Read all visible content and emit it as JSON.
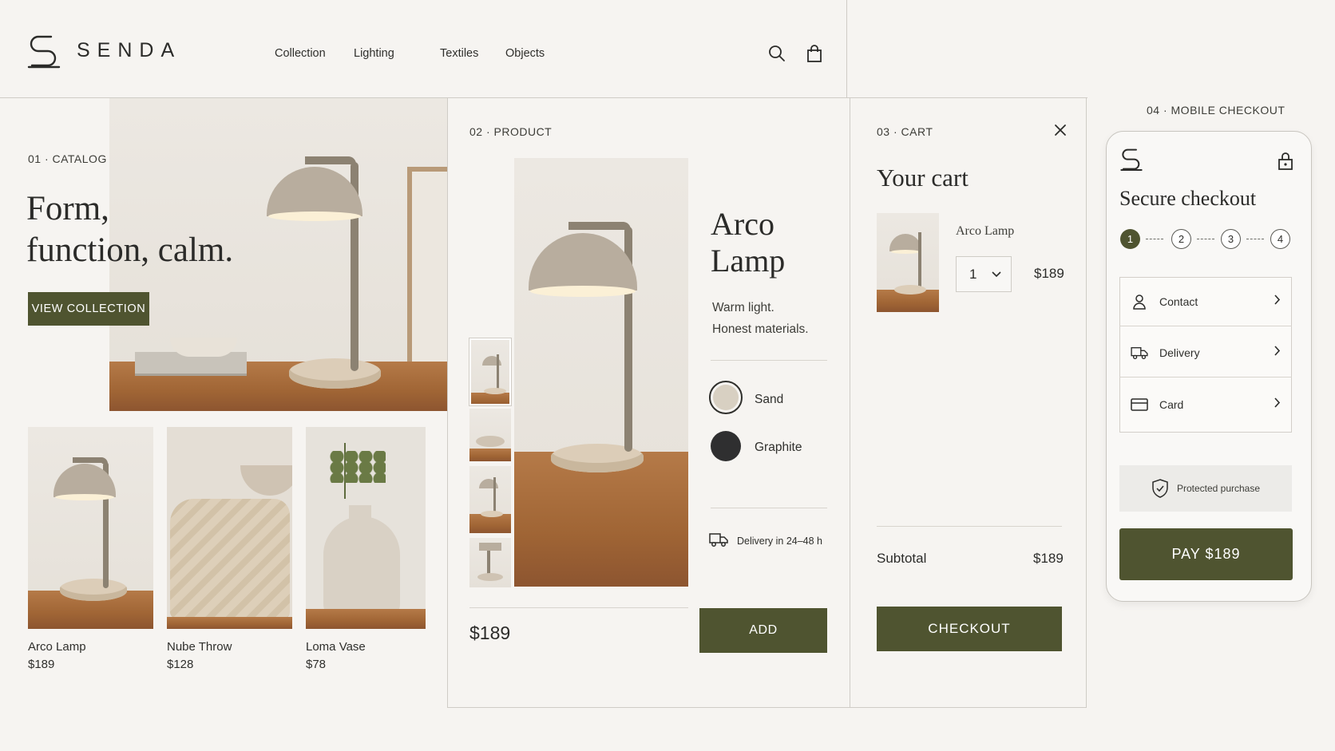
{
  "header": {
    "brand": "SENDA",
    "nav": [
      "Collection",
      "Lighting",
      "Textiles",
      "Objects"
    ]
  },
  "catalog": {
    "section_label": "01 · CATALOG",
    "headline_1": "Form,",
    "headline_2": "function, calm.",
    "cta": "VIEW COLLECTION",
    "products": [
      {
        "name": "Arco Lamp",
        "price": "$189"
      },
      {
        "name": "Nube Throw",
        "price": "$128"
      },
      {
        "name": "Loma Vase",
        "price": "$78"
      }
    ]
  },
  "product": {
    "section_label": "02 · PRODUCT",
    "title_1": "Arco",
    "title_2": "Lamp",
    "desc_1": "Warm light.",
    "desc_2": "Honest materials.",
    "colors": [
      {
        "name": "Sand",
        "hex": "#d8d0c2"
      },
      {
        "name": "Graphite",
        "hex": "#2f2f30"
      }
    ],
    "delivery": "Delivery in 24–48 h",
    "price": "$189",
    "add_button": "ADD"
  },
  "cart": {
    "section_label": "03 · CART",
    "title": "Your cart",
    "item_name": "Arco Lamp",
    "quantity": "1",
    "item_price": "$189",
    "subtotal_label": "Subtotal",
    "subtotal_value": "$189",
    "checkout_button": "CHECKOUT"
  },
  "mobile": {
    "section_label": "04 · MOBILE CHECKOUT",
    "title": "Secure checkout",
    "steps": [
      "1",
      "2",
      "3",
      "4"
    ],
    "rows": [
      "Contact",
      "Delivery",
      "Card"
    ],
    "protected": "Protected purchase",
    "pay_button": "PAY $189"
  },
  "colors": {
    "accent": "#4f5430",
    "background": "#f6f4f1"
  }
}
